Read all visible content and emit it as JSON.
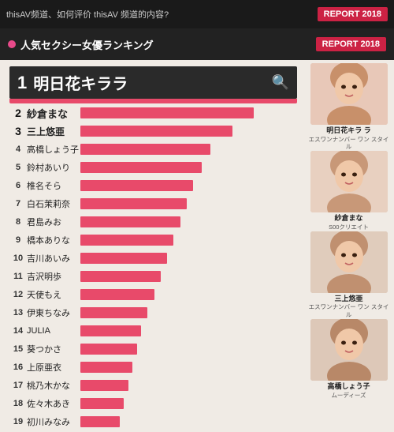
{
  "header": {
    "question_text": "thisAV频道、如何评价 thisAV 频道的内容?",
    "report_label": "REPORT 2018"
  },
  "banner": {
    "bullet_icon": "●",
    "title_prefix": "人気セクシー女優ランキング",
    "report_badge": "REPORT 2018"
  },
  "ranking": [
    {
      "rank": "1",
      "name": "明日花キララ",
      "bar_pct": 100,
      "is_top1": true
    },
    {
      "rank": "2",
      "name": "紗倉まな",
      "bar_pct": 80,
      "is_top2": true
    },
    {
      "rank": "3",
      "name": "三上悠亜",
      "bar_pct": 70,
      "is_top3": true
    },
    {
      "rank": "4",
      "name": "高橋しょう子",
      "bar_pct": 60
    },
    {
      "rank": "5",
      "name": "鈴村あいり",
      "bar_pct": 56
    },
    {
      "rank": "6",
      "name": "椎名そら",
      "bar_pct": 52
    },
    {
      "rank": "7",
      "name": "白石茉莉奈",
      "bar_pct": 49
    },
    {
      "rank": "8",
      "name": "君島みお",
      "bar_pct": 46
    },
    {
      "rank": "9",
      "name": "橋本ありな",
      "bar_pct": 43
    },
    {
      "rank": "10",
      "name": "吉川あいみ",
      "bar_pct": 40
    },
    {
      "rank": "11",
      "name": "吉沢明歩",
      "bar_pct": 37
    },
    {
      "rank": "12",
      "name": "天使もえ",
      "bar_pct": 34
    },
    {
      "rank": "13",
      "name": "伊東ちなみ",
      "bar_pct": 31
    },
    {
      "rank": "14",
      "name": "JULIA",
      "bar_pct": 28
    },
    {
      "rank": "15",
      "name": "葵つかさ",
      "bar_pct": 26
    },
    {
      "rank": "16",
      "name": "上原亜衣",
      "bar_pct": 24
    },
    {
      "rank": "17",
      "name": "桃乃木かな",
      "bar_pct": 22
    },
    {
      "rank": "18",
      "name": "佐々木あき",
      "bar_pct": 20
    },
    {
      "rank": "19",
      "name": "初川みなみ",
      "bar_pct": 18
    }
  ],
  "photos": [
    {
      "name": "明日花キラ\nラ",
      "sub": "エスワンナンバー\nワン スタイル",
      "color1": "#e8c8b8",
      "color2": "#c8906a"
    },
    {
      "name": "紗倉まな",
      "sub": "S00クリエイト",
      "color1": "#e8d0c0",
      "color2": "#c89878"
    },
    {
      "name": "三上悠亜",
      "sub": "エスワンナンバー\nワン スタイル",
      "color1": "#e0ccbc",
      "color2": "#c09070"
    },
    {
      "name": "高橋しょう子",
      "sub": "ムーディーズ",
      "color1": "#ddc8b8",
      "color2": "#b88868"
    }
  ]
}
